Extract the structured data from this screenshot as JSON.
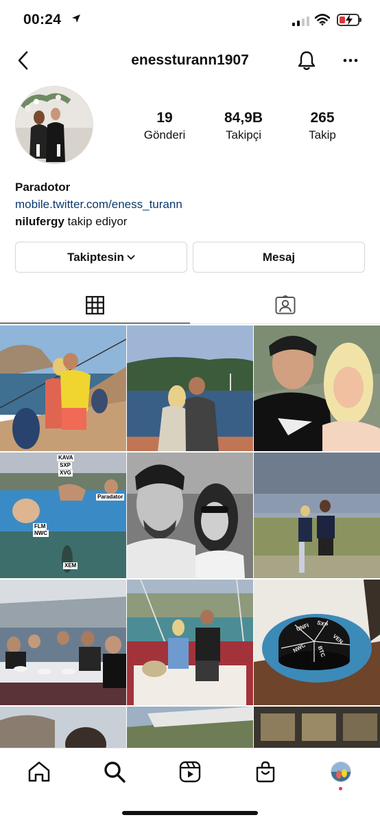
{
  "status_bar": {
    "time": "00:24",
    "colors": {
      "battery_low": "#e0353a"
    }
  },
  "header": {
    "username": "enessturann1907",
    "back_icon": "chevron-left-icon",
    "bell_icon": "bell-icon",
    "more_icon": "more-horizontal-icon"
  },
  "profile": {
    "stats": [
      {
        "value": "19",
        "label": "Gönderi"
      },
      {
        "value": "84,9B",
        "label": "Takipçi"
      },
      {
        "value": "265",
        "label": "Takip"
      }
    ],
    "display_name": "Paradotor",
    "link": "mobile.twitter.com/eness_turann",
    "followed_by_name": "nilufergy",
    "followed_by_text": " takip ediyor"
  },
  "actions": {
    "following_label": "Takiptesin",
    "message_label": "Mesaj"
  },
  "tabs": [
    {
      "name": "grid",
      "icon": "grid-icon",
      "active": true
    },
    {
      "name": "tagged",
      "icon": "tagged-person-icon",
      "active": false
    }
  ],
  "posts": {
    "tags_post4": {
      "t1": "KAVA",
      "t2": "SXP",
      "t3": "XVG",
      "t4": "Paradator",
      "t5": "FLM",
      "t6": "NWC",
      "t7": "XEM"
    },
    "cake_text": {
      "a": "UNFI",
      "b": "SXP",
      "c": "VEN",
      "d": "NWC",
      "e": "BTC"
    }
  },
  "bottom_nav": [
    "home-icon",
    "search-icon",
    "reels-icon",
    "shop-icon",
    "profile-avatar"
  ],
  "colors": {
    "link": "#0b3a6e",
    "accent_dot": "#e63946"
  }
}
